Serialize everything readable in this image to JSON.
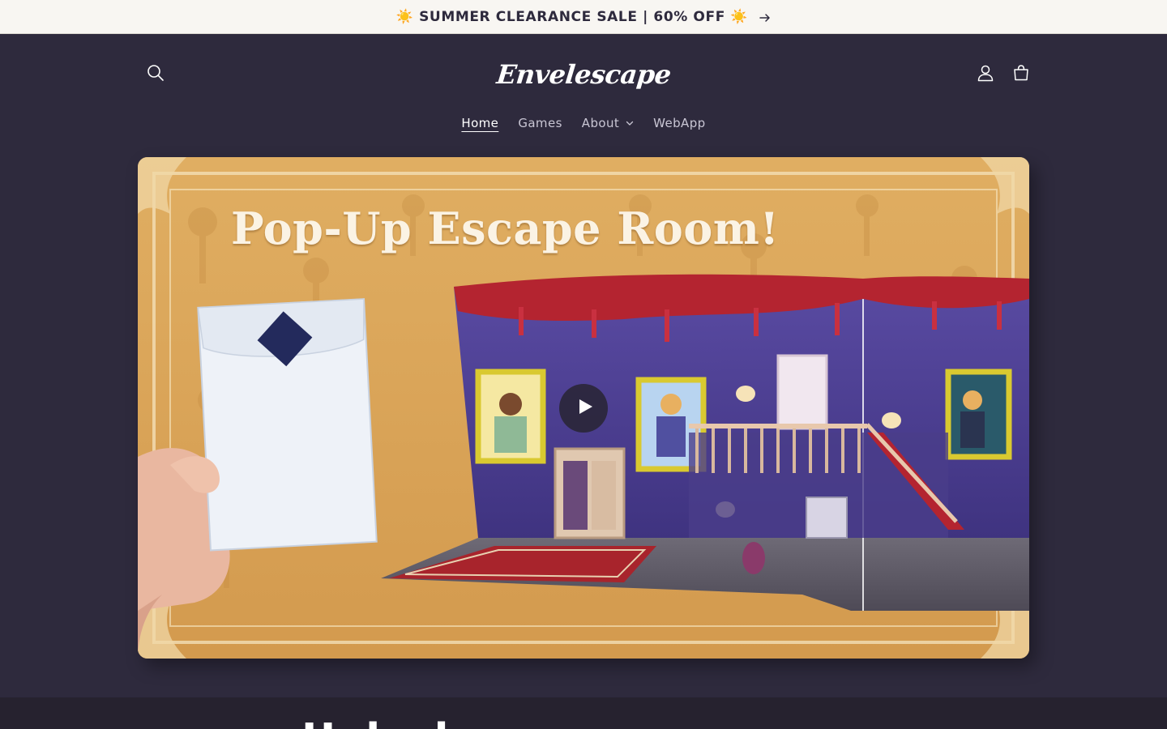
{
  "announcement": {
    "text": "☀️ SUMMER CLEARANCE SALE | 60% OFF ☀️",
    "arrow_icon": "arrow-right-icon"
  },
  "header": {
    "logo_text": "Envelescape",
    "icons": {
      "search": "search-icon",
      "account": "user-icon",
      "cart": "cart-icon"
    },
    "nav": [
      {
        "label": "Home",
        "active": true
      },
      {
        "label": "Games",
        "active": false
      },
      {
        "label": "About",
        "active": false,
        "has_dropdown": true
      },
      {
        "label": "WebApp",
        "active": false
      }
    ]
  },
  "hero": {
    "title": "Pop-Up Escape Room!",
    "play_icon": "play-icon"
  },
  "next_section": {
    "heading": "Unlock ..."
  },
  "colors": {
    "page_bg": "#2e2a3d",
    "announcement_bg": "#f8f6f2",
    "hero_bg": "#d9a458"
  }
}
